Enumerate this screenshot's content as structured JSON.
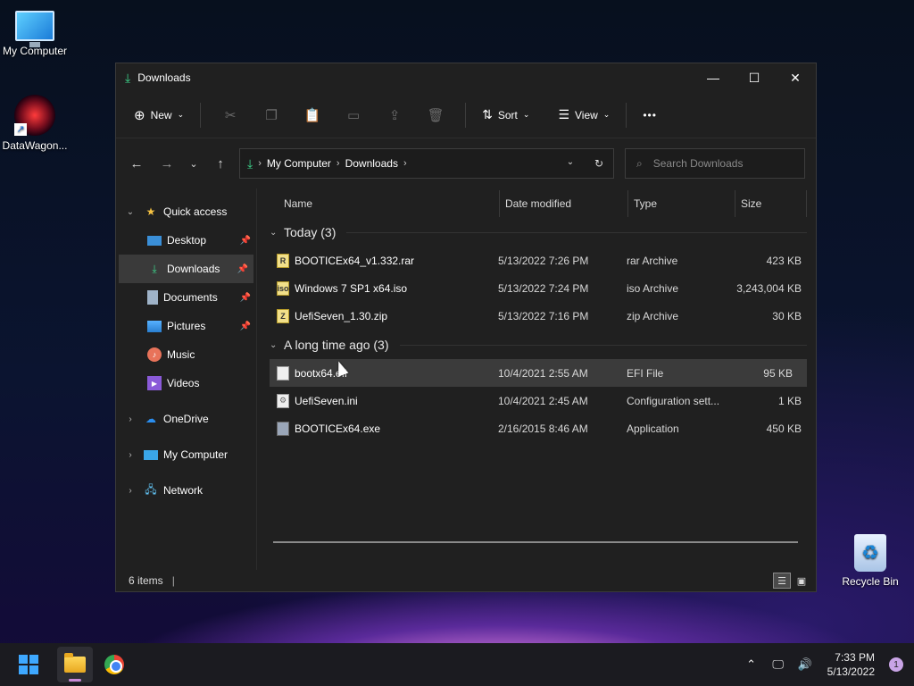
{
  "desktop": {
    "icons": [
      {
        "label": "My Computer",
        "icon": "monitor-icon"
      },
      {
        "label": "DataWagon...",
        "icon": "datawagon-icon"
      },
      {
        "label": "Recycle Bin",
        "icon": "recycle-bin-icon"
      }
    ]
  },
  "window": {
    "title": "Downloads",
    "controls": {
      "minimize": "—",
      "maximize": "☐",
      "close": "✕"
    }
  },
  "toolbar": {
    "new_label": "New",
    "sort_label": "Sort",
    "view_label": "View",
    "more_label": "•••"
  },
  "address": {
    "crumbs": [
      "My Computer",
      "Downloads"
    ],
    "search_placeholder": "Search Downloads"
  },
  "sidebar": {
    "items": [
      {
        "label": "Quick access"
      },
      {
        "label": "Desktop"
      },
      {
        "label": "Downloads"
      },
      {
        "label": "Documents"
      },
      {
        "label": "Pictures"
      },
      {
        "label": "Music"
      },
      {
        "label": "Videos"
      },
      {
        "label": "OneDrive"
      },
      {
        "label": "My Computer"
      },
      {
        "label": "Network"
      }
    ]
  },
  "columns": {
    "name": "Name",
    "date": "Date modified",
    "type": "Type",
    "size": "Size"
  },
  "groups": [
    {
      "label": "Today (3)",
      "files": [
        {
          "name": "BOOTICEx64_v1.332.rar",
          "date": "5/13/2022 7:26 PM",
          "type": "rar Archive",
          "size": "423 KB",
          "icon": "rar-icon"
        },
        {
          "name": "Windows 7 SP1 x64.iso",
          "date": "5/13/2022 7:24 PM",
          "type": "iso Archive",
          "size": "3,243,004 KB",
          "icon": "iso-icon"
        },
        {
          "name": "UefiSeven_1.30.zip",
          "date": "5/13/2022 7:16 PM",
          "type": "zip Archive",
          "size": "30 KB",
          "icon": "zip-icon"
        }
      ]
    },
    {
      "label": "A long time ago (3)",
      "files": [
        {
          "name": "bootx64.efi",
          "date": "10/4/2021 2:55 AM",
          "type": "EFI File",
          "size": "95 KB",
          "icon": "file-icon"
        },
        {
          "name": "UefiSeven.ini",
          "date": "10/4/2021 2:45 AM",
          "type": "Configuration sett...",
          "size": "1 KB",
          "icon": "config-file-icon"
        },
        {
          "name": "BOOTICEx64.exe",
          "date": "2/16/2015 8:46 AM",
          "type": "Application",
          "size": "450 KB",
          "icon": "app-icon"
        }
      ]
    }
  ],
  "status": {
    "items": "6 items",
    "cursor": "|"
  },
  "taskbar": {
    "time": "7:33 PM",
    "date": "5/13/2022",
    "notification_count": "1"
  }
}
